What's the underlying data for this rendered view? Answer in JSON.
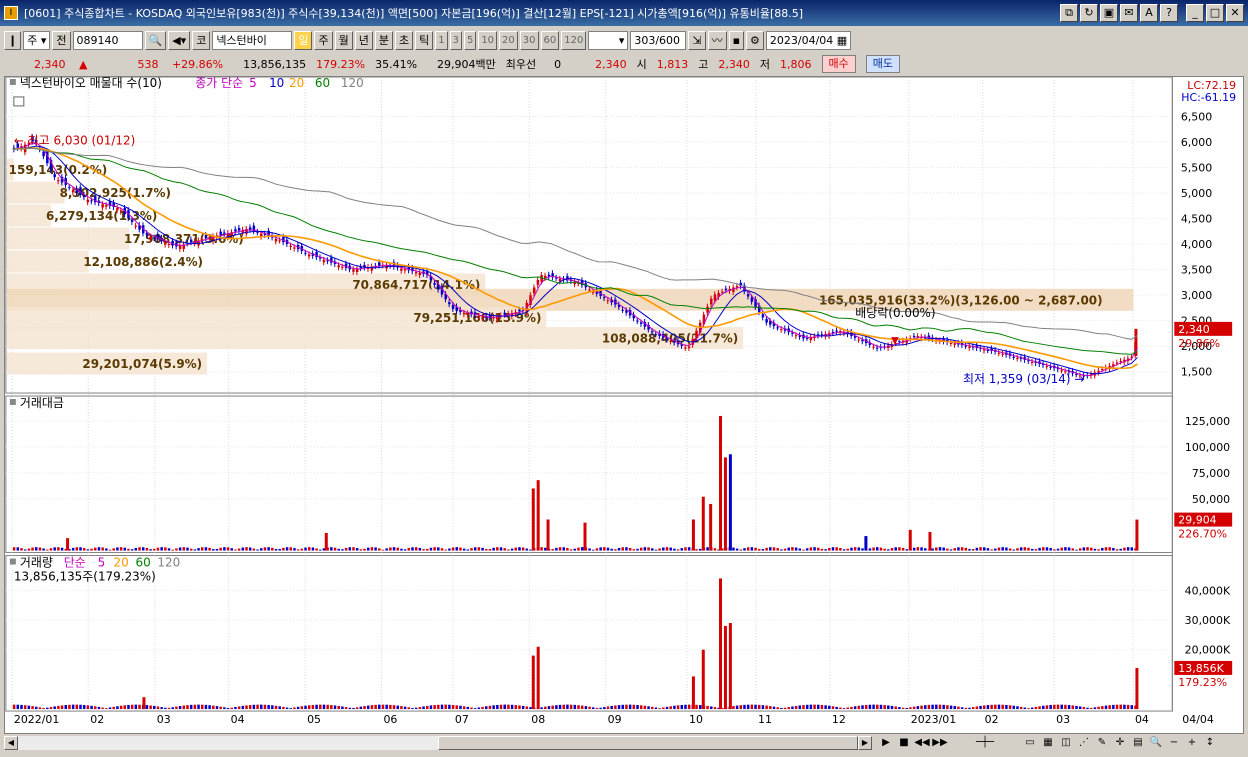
{
  "window": {
    "title": "[0601] 주식종합차트 - KOSDAQ 외국인보유[983(천)] 주식수[39,134(천)] 액면[500] 자본금[196(억)] 결산[12월] EPS[-121] 시가총액[916(억)] 유통비율[88.5]",
    "app_icon": "I"
  },
  "toolbar": {
    "market_select": "주",
    "prev_label": "전",
    "code": "089140",
    "stock_name": "넥스턴바이",
    "periods": [
      "일",
      "주",
      "월",
      "년",
      "분",
      "초",
      "틱"
    ],
    "intervals": [
      "1",
      "3",
      "5",
      "10",
      "20",
      "30",
      "60",
      "120"
    ],
    "count_value": "303",
    "count_total": "/600",
    "date": "2023/04/04",
    "active_period": "일",
    "label_code": "코"
  },
  "quote": {
    "price": "2,340",
    "change": "538",
    "change_pct": "+29.86%",
    "volume": "13,856,135",
    "volume_ratio": "179.23%",
    "turnover": "35.41%",
    "amount": "29,904백만",
    "best_label": "최우선",
    "best_value": "0",
    "best_price": "2,340",
    "open_label": "시",
    "open": "1,813",
    "high_label": "고",
    "high": "2,340",
    "low_label": "저",
    "low": "1,806",
    "buy_label": "매수",
    "sell_label": "매도"
  },
  "chart_data": [
    {
      "type": "candlestick",
      "legend_title": "넥스턴바이오 매물대 수(10)",
      "indicator_label": "종가 단순",
      "ma_periods": [
        "5",
        "10",
        "20",
        "60",
        "120"
      ],
      "ma_colors": [
        "#c000c0",
        "#0000c8",
        "#ff9900",
        "#008000",
        "#808080"
      ],
      "lc_label": "LC:72.19",
      "hc_label": "HC:-61.19",
      "y_ticks": [
        "1,500",
        "2,000",
        "2,500",
        "3,000",
        "3,500",
        "4,000",
        "4,500",
        "5,000",
        "5,500",
        "6,000",
        "6,500"
      ],
      "y_range": [
        1200,
        7000
      ],
      "current_price_label": "2,340",
      "current_pct_label": "29.86%",
      "max_label": "최고 6,030 (01/12)",
      "min_label": "최저 1,359 (03/14)",
      "dividend_label": "배당락(0.00%)",
      "volume_profile": [
        {
          "label": "159,143(0.2%)",
          "price": 5450,
          "share": 0.2
        },
        {
          "label": "8,302,925(1.7%)",
          "price": 5000,
          "share": 1.7
        },
        {
          "label": "6,279,134(1.3%)",
          "price": 4550,
          "share": 1.3
        },
        {
          "label": "17,908,371(3.6%)",
          "price": 4100,
          "share": 3.6
        },
        {
          "label": "12,108,886(2.4%)",
          "price": 3650,
          "share": 2.4
        },
        {
          "label": "70,864,717(14.1%)",
          "price": 3200,
          "share": 14.1
        },
        {
          "label": "165,035,916(33.2%)(3,126.00 ~ 2,687.00)",
          "price": 2900,
          "share": 33.2
        },
        {
          "label": "79,251,166(15.9%)",
          "price": 2550,
          "share": 15.9
        },
        {
          "label": "108,088,405(21.7%)",
          "price": 2150,
          "share": 21.7
        },
        {
          "label": "29,201,074(5.9%)",
          "price": 1650,
          "share": 5.9
        }
      ],
      "close_series": [
        {
          "x": "2022/01/03",
          "y": 5850
        },
        {
          "x": "2022/01/12",
          "y": 6030
        },
        {
          "x": "2022/01/20",
          "y": 5300
        },
        {
          "x": "2022/02/03",
          "y": 4850
        },
        {
          "x": "2022/02/15",
          "y": 4700
        },
        {
          "x": "2022/02/25",
          "y": 4200
        },
        {
          "x": "2022/03/10",
          "y": 3950
        },
        {
          "x": "2022/03/25",
          "y": 4150
        },
        {
          "x": "2022/04/08",
          "y": 4300
        },
        {
          "x": "2022/04/20",
          "y": 4100
        },
        {
          "x": "2022/05/03",
          "y": 3800
        },
        {
          "x": "2022/05/20",
          "y": 3500
        },
        {
          "x": "2022/06/03",
          "y": 3600
        },
        {
          "x": "2022/06/20",
          "y": 3400
        },
        {
          "x": "2022/07/01",
          "y": 2700
        },
        {
          "x": "2022/07/15",
          "y": 2550
        },
        {
          "x": "2022/07/29",
          "y": 2700
        },
        {
          "x": "2022/08/05",
          "y": 3400
        },
        {
          "x": "2022/08/20",
          "y": 3250
        },
        {
          "x": "2022/09/05",
          "y": 2800
        },
        {
          "x": "2022/09/20",
          "y": 2250
        },
        {
          "x": "2022/10/04",
          "y": 1950
        },
        {
          "x": "2022/10/14",
          "y": 3000
        },
        {
          "x": "2022/10/25",
          "y": 3200
        },
        {
          "x": "2022/11/05",
          "y": 2450
        },
        {
          "x": "2022/11/20",
          "y": 2150
        },
        {
          "x": "2022/12/05",
          "y": 2300
        },
        {
          "x": "2022/12/20",
          "y": 1950
        },
        {
          "x": "2023/01/05",
          "y": 2200
        },
        {
          "x": "2023/01/20",
          "y": 2050
        },
        {
          "x": "2023/02/05",
          "y": 1900
        },
        {
          "x": "2023/02/20",
          "y": 1700
        },
        {
          "x": "2023/03/14",
          "y": 1400
        },
        {
          "x": "2023/03/28",
          "y": 1700
        },
        {
          "x": "2023/04/03",
          "y": 1802
        },
        {
          "x": "2023/04/04",
          "y": 2340
        }
      ],
      "x_ticks": [
        "2022/01",
        "02",
        "03",
        "04",
        "05",
        "06",
        "07",
        "08",
        "09",
        "10",
        "11",
        "12",
        "2023/01",
        "02",
        "03",
        "04"
      ],
      "x_end_label": "04/04"
    },
    {
      "type": "bar",
      "title": "거래대금",
      "y_ticks": [
        "50,000",
        "75,000",
        "100,000",
        "125,000"
      ],
      "y_range": [
        0,
        130000
      ],
      "current_label": "29,904",
      "pct_label": "226.70%",
      "highlights": [
        {
          "x": "2022/01/25",
          "y": 12000,
          "color": "#d40000"
        },
        {
          "x": "2022/05/10",
          "y": 17000,
          "color": "#d40000"
        },
        {
          "x": "2022/08/02",
          "y": 60000,
          "color": "#d40000"
        },
        {
          "x": "2022/08/04",
          "y": 68000,
          "color": "#d40000"
        },
        {
          "x": "2022/08/08",
          "y": 30000,
          "color": "#d40000"
        },
        {
          "x": "2022/08/23",
          "y": 27000,
          "color": "#d40000"
        },
        {
          "x": "2022/10/06",
          "y": 30000,
          "color": "#d40000"
        },
        {
          "x": "2022/10/10",
          "y": 52000,
          "color": "#d40000"
        },
        {
          "x": "2022/10/13",
          "y": 45000,
          "color": "#d40000"
        },
        {
          "x": "2022/10/17",
          "y": 130000,
          "color": "#d40000"
        },
        {
          "x": "2022/10/19",
          "y": 90000,
          "color": "#d40000"
        },
        {
          "x": "2022/10/21",
          "y": 93000,
          "color": "#0000c8"
        },
        {
          "x": "2022/12/15",
          "y": 14000,
          "color": "#0000c8"
        },
        {
          "x": "2023/01/02",
          "y": 20000,
          "color": "#d40000"
        },
        {
          "x": "2023/01/10",
          "y": 18000,
          "color": "#d40000"
        },
        {
          "x": "2023/04/04",
          "y": 29904,
          "color": "#d40000"
        }
      ]
    },
    {
      "type": "bar",
      "title": "거래량",
      "indicator_label": "단순",
      "ma_periods": [
        "5",
        "20",
        "60",
        "120"
      ],
      "volume_text": "13,856,135주(179.23%)",
      "y_ticks": [
        "20,000K",
        "30,000K",
        "40,000K"
      ],
      "y_range": [
        0,
        45000
      ],
      "current_label": "13,856K",
      "pct_label": "179.23%",
      "highlights": [
        {
          "x": "2022/02/25",
          "y": 4000,
          "color": "#d40000"
        },
        {
          "x": "2022/08/02",
          "y": 18000,
          "color": "#d40000"
        },
        {
          "x": "2022/08/04",
          "y": 21000,
          "color": "#d40000"
        },
        {
          "x": "2022/10/06",
          "y": 11000,
          "color": "#d40000"
        },
        {
          "x": "2022/10/10",
          "y": 20000,
          "color": "#d40000"
        },
        {
          "x": "2022/10/17",
          "y": 44000,
          "color": "#d40000"
        },
        {
          "x": "2022/10/19",
          "y": 28000,
          "color": "#d40000"
        },
        {
          "x": "2022/10/21",
          "y": 29000,
          "color": "#d40000"
        },
        {
          "x": "2023/04/04",
          "y": 13856,
          "color": "#d40000"
        }
      ]
    }
  ],
  "colors": {
    "up": "#d40000",
    "down": "#0000c8",
    "profile": "#f5e3cf",
    "profile_max": "#efd4b5"
  }
}
